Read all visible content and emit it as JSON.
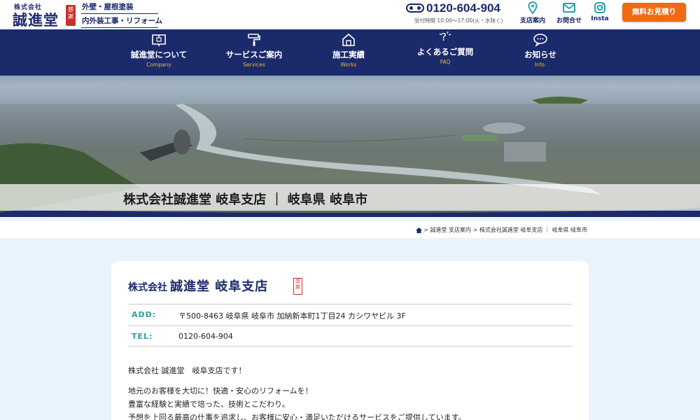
{
  "header": {
    "logo": {
      "small": "株式会社",
      "big": "誠進堂",
      "seal": "感謝"
    },
    "taglines": [
      "外壁・屋根塗装",
      "内外装工事・リフォーム"
    ],
    "phone": {
      "number": "0120-604-904",
      "hours": "受付時間 10:00〜17:00(火・水除く)"
    },
    "utility": [
      {
        "label": "支店案内",
        "icon": "map-pin-icon"
      },
      {
        "label": "お問合せ",
        "icon": "mail-icon"
      },
      {
        "label": "Insta",
        "icon": "instagram-icon"
      }
    ],
    "estimate_button": "無料お見積り"
  },
  "nav": [
    {
      "jp": "誠進堂について",
      "en": "Company",
      "icon": "book-icon"
    },
    {
      "jp": "サービスご案内",
      "en": "Services",
      "icon": "paint-roller-icon"
    },
    {
      "jp": "施工実績",
      "en": "Works",
      "icon": "house-icon"
    },
    {
      "jp": "よくあるご質問",
      "en": "FAQ",
      "icon": "question-icon"
    },
    {
      "jp": "お知らせ",
      "en": "Info.",
      "icon": "chat-bubble-icon"
    }
  ],
  "hero": {
    "title": "株式会社誠進堂 岐阜支店 ｜ 岐阜県 岐阜市"
  },
  "breadcrumb": {
    "text": "> 誠進堂 支店案内 > 株式会社誠進堂 岐阜支店 ｜ 岐阜県 岐阜市",
    "icon": "home-icon"
  },
  "branch": {
    "heading_prefix": "株式会社",
    "heading_main": "誠進堂 岐阜支店",
    "seal": "感謝",
    "info": [
      {
        "key": "ADD:",
        "value": "〒500-8463 岐阜県 岐阜市 加納新本町1丁目24 カシワヤビル 3F"
      },
      {
        "key": "TEL:",
        "value": "0120-604-904"
      }
    ],
    "paragraphs": [
      "株式会社 誠進堂　岐阜支店です！",
      "地元のお客様を大切に！快適・安心のリフォームを！",
      "豊富な経験と実績で培った、技術とこだわり。",
      "予想を上回る最高の仕事を追求し、お客様に安心・満足いただけるサービスをご提供しています。"
    ]
  },
  "colors": {
    "navy": "#1b2a6b",
    "orange": "#ef6a12",
    "teal": "#2aa1a5",
    "gold": "#f1b63b",
    "red": "#c9302c"
  }
}
